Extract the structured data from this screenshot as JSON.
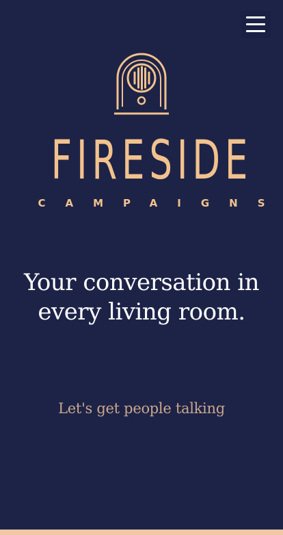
{
  "header": {
    "menu_icon": "hamburger-menu-icon"
  },
  "brand": {
    "logo_icon": "vintage-radio-icon",
    "name": "FIRESIDE",
    "subtitle": "CAMPAIGNS"
  },
  "hero": {
    "headline": "Your conversation in every living room.",
    "tagline": "Let's get people talking"
  },
  "colors": {
    "background": "#1d2347",
    "accent": "#f2c28e",
    "tagline": "#c9a88d",
    "headline": "#ffffff",
    "bottom_strip": "#f0c8a4"
  }
}
